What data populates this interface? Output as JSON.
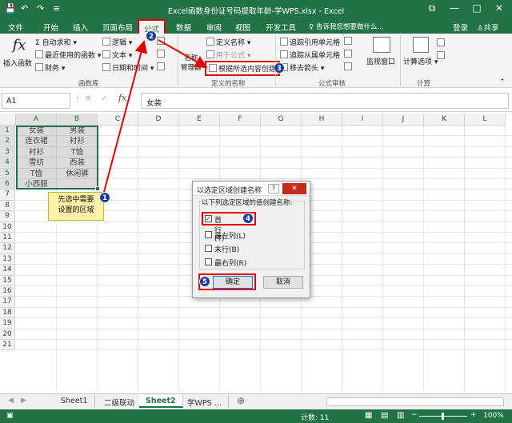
{
  "title": "Excel函数身份证号码提取年龄-学WPS.xlsx - Excel",
  "quick_access": {
    "save": "💾",
    "undo": "↶",
    "redo": "↷",
    "customize": "≡"
  },
  "window_controls": {
    "restore": "⧉",
    "minimize": "—",
    "maximize": "□",
    "close": "✕"
  },
  "tabs": [
    "文件",
    "开始",
    "插入",
    "页面布局",
    "公式",
    "数据",
    "审阅",
    "视图",
    "开发工具"
  ],
  "tell_me": "告诉我您想要做什么...",
  "login": "登录",
  "share": "共享",
  "ribbon": {
    "insert_function": "插入函数",
    "autosum": "自动求和",
    "recent": "最近使用的函数",
    "financial": "财务",
    "logical": "逻辑",
    "text": "文本",
    "datetime": "日期和时间",
    "group_library": "函数库",
    "name_manager": "名称\n管理器",
    "define_name": "定义名称",
    "use_in_formula": "用于公式",
    "create_from_selection": "根据所选内容创建",
    "group_names": "定义的名称",
    "trace_precedents": "追踪引用单元格",
    "trace_dependents": "追踪从属单元格",
    "remove_arrows": "移去箭头",
    "group_audit": "公式审核",
    "watch_window": "监视窗口",
    "calc_options": "计算选项",
    "group_calc": "计算"
  },
  "namebox": "A1",
  "formula_value": "女装",
  "columns": [
    "A",
    "B",
    "C",
    "D",
    "E",
    "F",
    "G",
    "H",
    "I",
    "J",
    "K",
    "L"
  ],
  "rows": [
    "1",
    "2",
    "3",
    "4",
    "5",
    "6",
    "7",
    "8",
    "9",
    "10",
    "11",
    "12",
    "13",
    "14",
    "15",
    "16",
    "17",
    "18",
    "19",
    "20",
    "21"
  ],
  "cells": [
    [
      "女装",
      "男装"
    ],
    [
      "连衣裙",
      "衬衫"
    ],
    [
      "衬衫",
      "T恤"
    ],
    [
      "雪纺",
      "西装"
    ],
    [
      "T恤",
      "休闲裤"
    ],
    [
      "小西服",
      ""
    ]
  ],
  "callout": "先选中需要\n设置的区域",
  "steps": [
    "1",
    "2",
    "3",
    "4",
    "5"
  ],
  "dialog": {
    "title": "以选定区域创建名称",
    "help": "?",
    "close": "✕",
    "group_label": "以下列选定区域的值创建名称:",
    "options": [
      {
        "label": "首行(T)",
        "checked": true
      },
      {
        "label": "最左列(L)",
        "checked": false
      },
      {
        "label": "末行(B)",
        "checked": false
      },
      {
        "label": "最右列(R)",
        "checked": false
      }
    ],
    "ok": "确定",
    "cancel": "取消"
  },
  "sheets": [
    "Sheet1",
    "二级联动",
    "Sheet2",
    "学WPS ..."
  ],
  "active_sheet": "Sheet2",
  "add_sheet": "⊕",
  "status": {
    "count": "计数: 11",
    "zoom": "100%"
  },
  "colors": {
    "brand": "#217346",
    "highlight": "#e00000",
    "step": "#1b3a9a"
  }
}
